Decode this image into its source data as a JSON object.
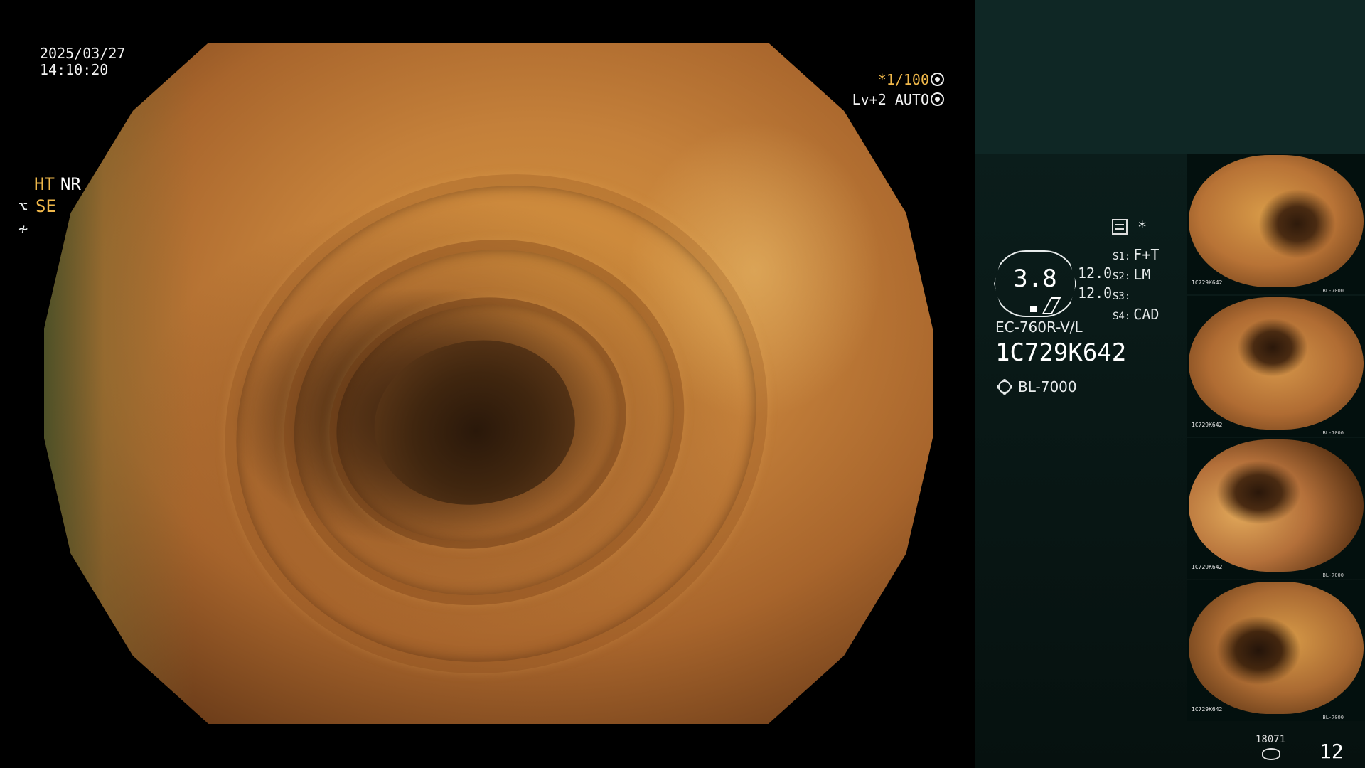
{
  "overlay": {
    "date": "2025/03/27",
    "time": "14:10:20",
    "shutter": "*1/100",
    "iris": "Lv+2 AUTO"
  },
  "processing": {
    "ht": "HT",
    "nr": "NR",
    "se": "SE"
  },
  "zoom": {
    "value": "3.8",
    "levels": [
      "12.0",
      "12.0"
    ]
  },
  "mode_marker": "*",
  "switches": [
    {
      "key": "S1:",
      "value": "F+T"
    },
    {
      "key": "S2:",
      "value": "LM"
    },
    {
      "key": "S3:",
      "value": ""
    },
    {
      "key": "S4:",
      "value": "CAD"
    }
  ],
  "scope": {
    "model": "EC-760R-V/L",
    "serial": "1C729K642",
    "light_source": "BL-7000"
  },
  "thumbnails": [
    {
      "serial": "1C729K642",
      "light": "BL-7000"
    },
    {
      "serial": "1C729K642",
      "light": "BL-7000"
    },
    {
      "serial": "1C729K642",
      "light": "BL-7000"
    },
    {
      "serial": "1C729K642",
      "light": "BL-7000"
    }
  ],
  "footer": {
    "frame_code": "18071",
    "image_count": "12"
  },
  "colors": {
    "accent_amber": "#f0b84a",
    "panel_top": "#0f2725",
    "panel_body": "#06110f"
  },
  "icons": [
    "shape-enhance-icon",
    "iris-auto-icon",
    "structure-enhance-icon",
    "freeze-icon",
    "menu-icon",
    "zoom-gauge-icon",
    "light-source-icon",
    "disk-icon"
  ]
}
